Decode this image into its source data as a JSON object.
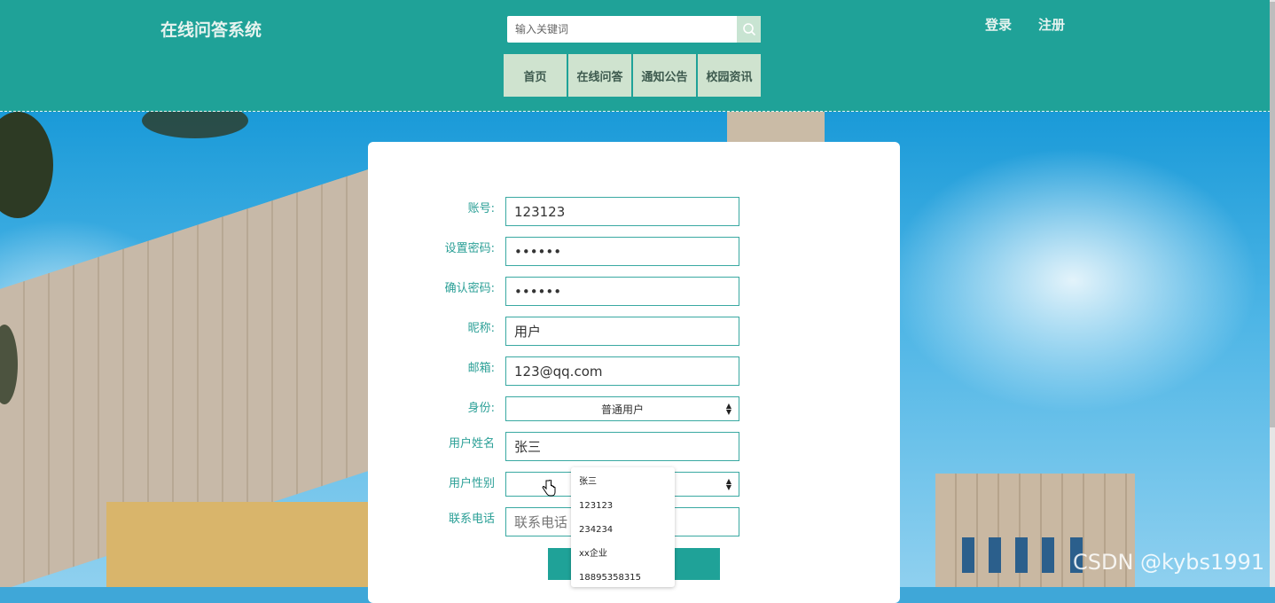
{
  "header": {
    "site_title": "在线问答系统",
    "search_placeholder": "输入关键词",
    "login": "登录",
    "register": "注册",
    "nav": [
      "首页",
      "在线问答",
      "通知公告",
      "校园资讯"
    ]
  },
  "form": {
    "account": {
      "label": "账号:",
      "value": "123123"
    },
    "password": {
      "label": "设置密码:",
      "value": "••••••"
    },
    "confirm_password": {
      "label": "确认密码:",
      "value": "••••••"
    },
    "nickname": {
      "label": "昵称:",
      "value": "用户"
    },
    "email": {
      "label": "邮箱:",
      "value": "123@qq.com"
    },
    "identity": {
      "label": "身份:",
      "value": "普通用户"
    },
    "real_name": {
      "label": "用户姓名",
      "value": "张三"
    },
    "gender": {
      "label": "用户性别",
      "value": ""
    },
    "phone": {
      "label": "联系电话",
      "placeholder": "联系电话"
    }
  },
  "autocomplete": [
    "张三",
    "123123",
    "234234",
    "xx企业",
    "18895358315"
  ],
  "watermark": "CSDN @kybs1991",
  "colors": {
    "accent": "#1fa298",
    "nav_bg": "#cfe3cf",
    "label": "#2a9f96"
  }
}
